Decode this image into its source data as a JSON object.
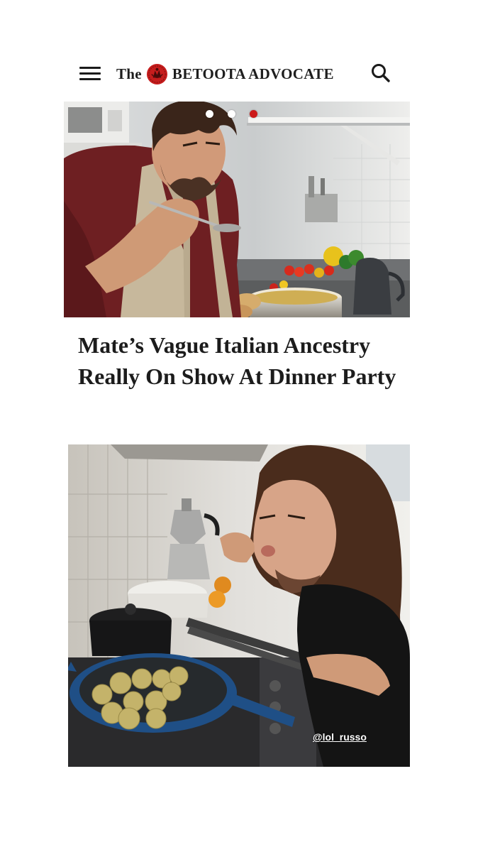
{
  "header": {
    "menu_icon": "hamburger-menu-icon",
    "logo": {
      "prefix": "The",
      "seal_icon": "betoota-seal-icon",
      "name": "BETOOTA ADVOCATE"
    },
    "search_icon": "search-icon"
  },
  "hero": {
    "carousel": {
      "count": 3,
      "active_index": 2,
      "active_color": "#cc1a1a",
      "inactive_color": "#ffffff"
    }
  },
  "article": {
    "headline": "Mate’s Vague Italian Ancestry Really On Show At Dinner Party"
  },
  "second_photo": {
    "watermark": "@lol_russo"
  },
  "colors": {
    "text": "#1c1c1c",
    "accent_red": "#cc1a1a",
    "background": "#ffffff"
  }
}
